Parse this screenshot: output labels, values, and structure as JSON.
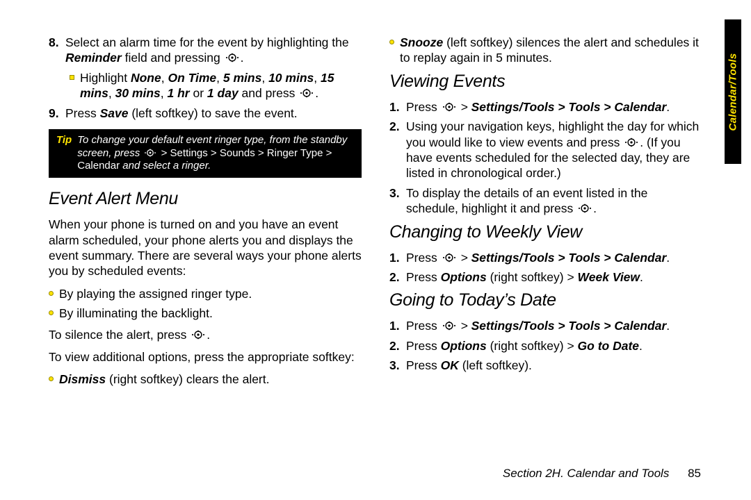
{
  "sidetab": "Calendar/Tools",
  "footer": {
    "section": "Section 2H. Calendar and Tools",
    "page": "85"
  },
  "left": {
    "item8_a": "Select an alarm time for the event by highlighting the ",
    "item8_b": "Reminder",
    "item8_c": " field and pressing ",
    "item8_d": ".",
    "sub_a": "Highlight ",
    "sub_b": "None",
    "sub_c": ", ",
    "sub_d": "On Time",
    "sub_e": ", ",
    "sub_f": "5 mins",
    "sub_g": ", ",
    "sub_h": "10 mins",
    "sub_i": ", ",
    "sub_j": "15 mins",
    "sub_k": ", ",
    "sub_l": "30 mins",
    "sub_m": ", ",
    "sub_n": "1 hr",
    "sub_o": " or ",
    "sub_p": "1 day",
    "sub_q": " and press ",
    "sub_r": ".",
    "item9_a": "Press ",
    "item9_b": "Save",
    "item9_c": " (left softkey) to save the event.",
    "tip_label": "Tip",
    "tip_a": "To change your default event ringer type, from the standby screen, press ",
    "tip_b": " > Settings > Sounds > Ringer Type > Calendar ",
    "tip_c": "and select a ringer.",
    "h_eventalert": "Event Alert Menu",
    "para1": "When your phone is turned on and you have an event alarm scheduled, your phone alerts you and displays the event summary. There are several ways your phone alerts you by scheduled events:",
    "b1": "By playing the assigned ringer type.",
    "b2": "By illuminating the backlight.",
    "para2_a": "To silence the alert, press ",
    "para2_b": ".",
    "para3": "To view additional options, press the appropriate softkey:",
    "b3_a": "Dismiss",
    "b3_b": " (right softkey) clears the alert."
  },
  "right": {
    "b0_a": "Snooze",
    "b0_b": " (left softkey) silences the alert and schedules it to replay again in 5 minutes.",
    "h_view": "Viewing Events",
    "v1_a": "Press ",
    "v1_b": " > ",
    "v1_c": "Settings/Tools > Tools > Calendar",
    "v1_d": ".",
    "v2_a": "Using your navigation keys, highlight the day for which you would like to view events and press ",
    "v2_b": ". (If you have events scheduled for the selected day, they are listed in chronological order.)",
    "v3_a": "To display the details of an event listed in the schedule, highlight it and press ",
    "v3_b": ".",
    "h_week": "Changing to Weekly View",
    "w1_a": "Press ",
    "w1_b": " > ",
    "w1_c": "Settings/Tools > Tools > Calendar",
    "w1_d": ".",
    "w2_a": "Press ",
    "w2_b": "Options",
    "w2_c": " (right softkey) > ",
    "w2_d": "Week View",
    "w2_e": ".",
    "h_today": "Going to Today’s Date",
    "t1_a": "Press ",
    "t1_b": " > ",
    "t1_c": "Settings/Tools > Tools > Calendar",
    "t1_d": ".",
    "t2_a": "Press ",
    "t2_b": "Options",
    "t2_c": " (right softkey) > ",
    "t2_d": "Go to Date",
    "t2_e": ".",
    "t3_a": "Press ",
    "t3_b": "OK",
    "t3_c": " (left softkey)."
  }
}
